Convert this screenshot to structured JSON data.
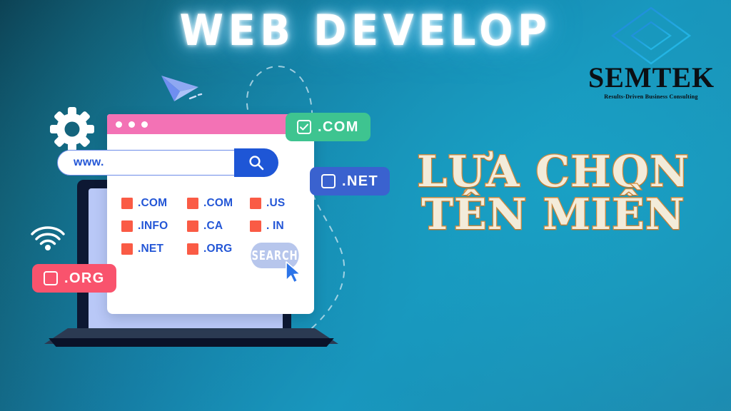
{
  "hero": {
    "title": "WEB DEVELOP"
  },
  "logo": {
    "name": "SEMTEK",
    "tagline": "Results-Driven Business Consulting",
    "mark": "diamond-logo-icon"
  },
  "headline": {
    "line1": "LỰA CHỌN",
    "line2": "TÊN MIỀN"
  },
  "browser": {
    "window_dots": [
      "dot-1",
      "dot-2",
      "dot-3"
    ],
    "search": {
      "value": "www.",
      "placeholder": "www.",
      "button_icon": "magnifier-icon"
    },
    "domains": [
      ".COM",
      ".COM",
      ".US",
      ".INFO",
      ".CA",
      ". IN",
      ".NET",
      ".ORG"
    ],
    "search_button_label": "SEARCH",
    "cursor": "mouse-pointer-icon"
  },
  "badges": [
    {
      "label": ".COM",
      "checked": true,
      "color": "#3ec490"
    },
    {
      "label": ".NET",
      "checked": false,
      "color": "#3a62cf"
    },
    {
      "label": ".ORG",
      "checked": false,
      "color": "#f9536d"
    }
  ],
  "decorations": {
    "gear": "gear-icon",
    "wifi": "wifi-icon",
    "plane": "paper-plane-icon",
    "dashed_loop": "dashed-curve"
  },
  "colors": {
    "bg_dark": "#0c3d4e",
    "bg_light": "#1a9cc4",
    "pink_bar": "#f372b5",
    "blue_accent": "#2356d6",
    "orange_square": "#fa5b45",
    "cream": "#f3ecda",
    "cream_outline": "#d08a3e",
    "laptop_dark": "#0d1833",
    "laptop_screen": "#b9c8f7"
  }
}
